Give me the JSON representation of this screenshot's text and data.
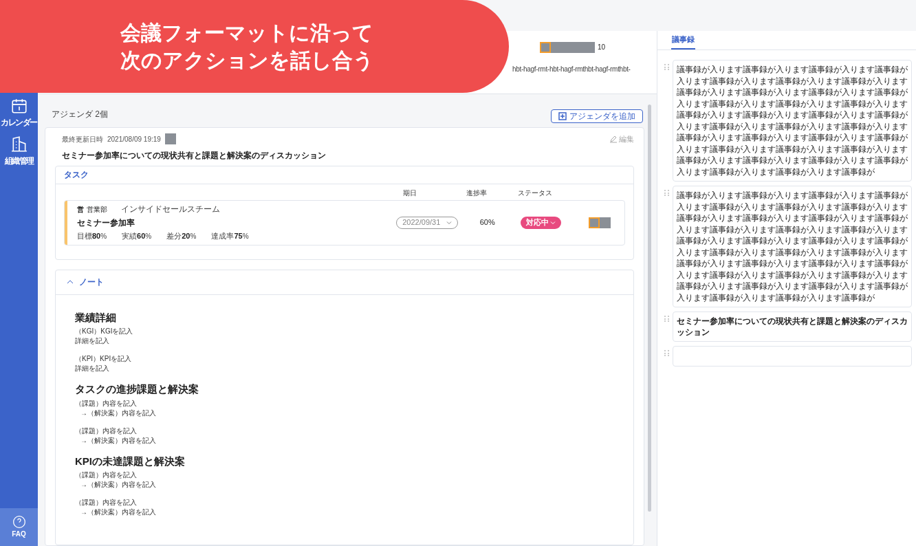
{
  "overlay": {
    "lines": [
      "会議フォーマットに沿って",
      "次のアクションを話し合う"
    ]
  },
  "sidebar": {
    "items": [
      {
        "label": "カレンダー",
        "kind": "calendar",
        "selected": false
      },
      {
        "label": "組織管理",
        "kind": "building",
        "selected": false
      }
    ],
    "footer": {
      "label": "FAQ"
    }
  },
  "meeting": {
    "link": "hbt-hagf-rmt-hbt-hagf-rmthbt-hagf-rmthbt-",
    "member_count": "10"
  },
  "agenda": {
    "count": "アジェンダ 2個",
    "add_button": "アジェンダを追加",
    "updated_label": "最終更新日時",
    "updated_at": "2021/08/09 19:19",
    "edit": "編集",
    "title": "セミナー参加率についての現状共有と課題と解決案のディスカッション",
    "tasks": {
      "title": "タスク",
      "columns": [
        "期日",
        "進捗率",
        "ステータス"
      ],
      "rows": [
        {
          "dept_icon": "営",
          "dept": "営業部",
          "team": "インサイドセールスチーム",
          "name": "セミナー参加率",
          "metrics": [
            {
              "label": "目標",
              "value": "80",
              "unit": "%"
            },
            {
              "label": "実績",
              "value": "60",
              "unit": "%"
            },
            {
              "label": "差分",
              "value": "20",
              "unit": "%"
            },
            {
              "label": "達成率",
              "value": "75",
              "unit": "%"
            }
          ],
          "due": "2022/09/31",
          "progress": "60%",
          "status": "対応中",
          "color": "#f9c46b"
        }
      ]
    },
    "note": {
      "title": "ノート",
      "expanded": true,
      "sections": [
        {
          "heading": "業績詳細",
          "blocks": [
            [
              "（KGI）KGIを記入",
              "詳細を記入"
            ],
            [
              "（KPI）KPIを記入",
              "詳細を記入"
            ]
          ]
        },
        {
          "heading": "タスクの進捗課題と解決案",
          "blocks": [
            [
              "（課題）内容を記入",
              "→（解決案）内容を記入"
            ],
            [
              "（課題）内容を記入",
              "→（解決案）内容を記入"
            ]
          ]
        },
        {
          "heading": "KPIの未達課題と解決案",
          "blocks": [
            [
              "（課題）内容を記入",
              "→（解決案）内容を記入"
            ],
            [
              "（課題）内容を記入",
              "→（解決案）内容を記入"
            ]
          ]
        }
      ]
    }
  },
  "minutes": {
    "tab": "議事録",
    "entries": [
      {
        "kind": "text",
        "text": "議事録が入ります議事録が入ります議事録が入ります議事録が入ります議事録が入ります議事録が入ります議事録が入ります議事録が入ります議事録が入ります議事録が入ります議事録が入ります議事録が入ります議事録が入ります議事録が入ります議事録が入ります議事録が入ります議事録が入ります議事録が入ります議事録が入ります議事録が入ります議事録が入ります議事録が入ります議事録が入ります議事録が入ります議事録が入ります議事録が入ります議事録が入ります議事録が入ります議事録が入ります議事録が入ります議事録が入ります議事録が入ります議事録が入ります議事録が入ります議事録が"
      },
      {
        "kind": "text",
        "text": "議事録が入ります議事録が入ります議事録が入ります議事録が入ります議事録が入ります議事録が入ります議事録が入ります議事録が入ります議事録が入ります議事録が入ります議事録が入ります議事録が入ります議事録が入ります議事録が入ります議事録が入ります議事録が入ります議事録が入ります議事録が入ります議事録が入ります議事録が入ります議事録が入ります議事録が入ります議事録が入ります議事録が入ります議事録が入ります議事録が入ります議事録が入ります議事録が入ります議事録が入ります議事録が入ります議事録が入ります議事録が入ります議事録が入ります議事録が入ります議事録が"
      },
      {
        "kind": "heading",
        "text": "セミナー参加率についての現状共有と課題と解決案のディスカッション"
      },
      {
        "kind": "empty"
      }
    ]
  }
}
